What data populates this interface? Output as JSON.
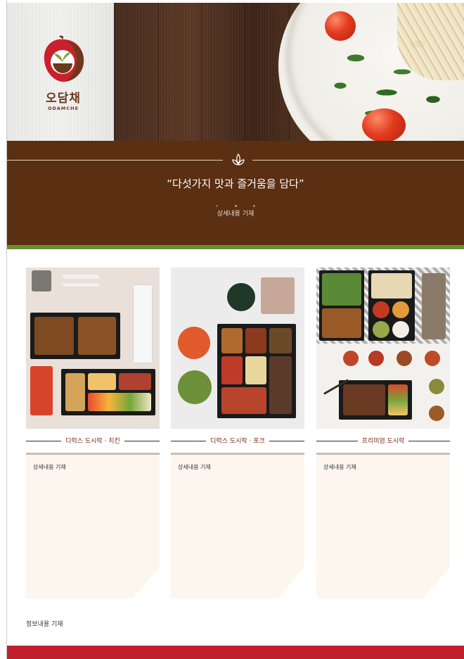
{
  "brand": {
    "name_korean": "오담채",
    "name_english": "ODAMCHE"
  },
  "banner": {
    "slogan": "“다섯가지 맛과 즐거움을 담다”",
    "subtitle": "상세내용 기재",
    "dot_colors": [
      "#d2462e",
      "#e0a040",
      "#7aa23c"
    ]
  },
  "products": [
    {
      "name": "디럭스 도시락 · 치킨",
      "detail": "상세내용 기재"
    },
    {
      "name": "디럭스 도시락 · 포크",
      "detail": "상세내용 기재"
    },
    {
      "name": "프리미엄 도시락",
      "detail": "상세내용 기재"
    }
  ],
  "footer": {
    "info": "정보내용 기재"
  },
  "colors": {
    "brown": "#5a2f12",
    "green": "#6a8e31",
    "red": "#c0202c",
    "card_bg": "#fdf6ef",
    "label_text": "#7a2b17"
  }
}
